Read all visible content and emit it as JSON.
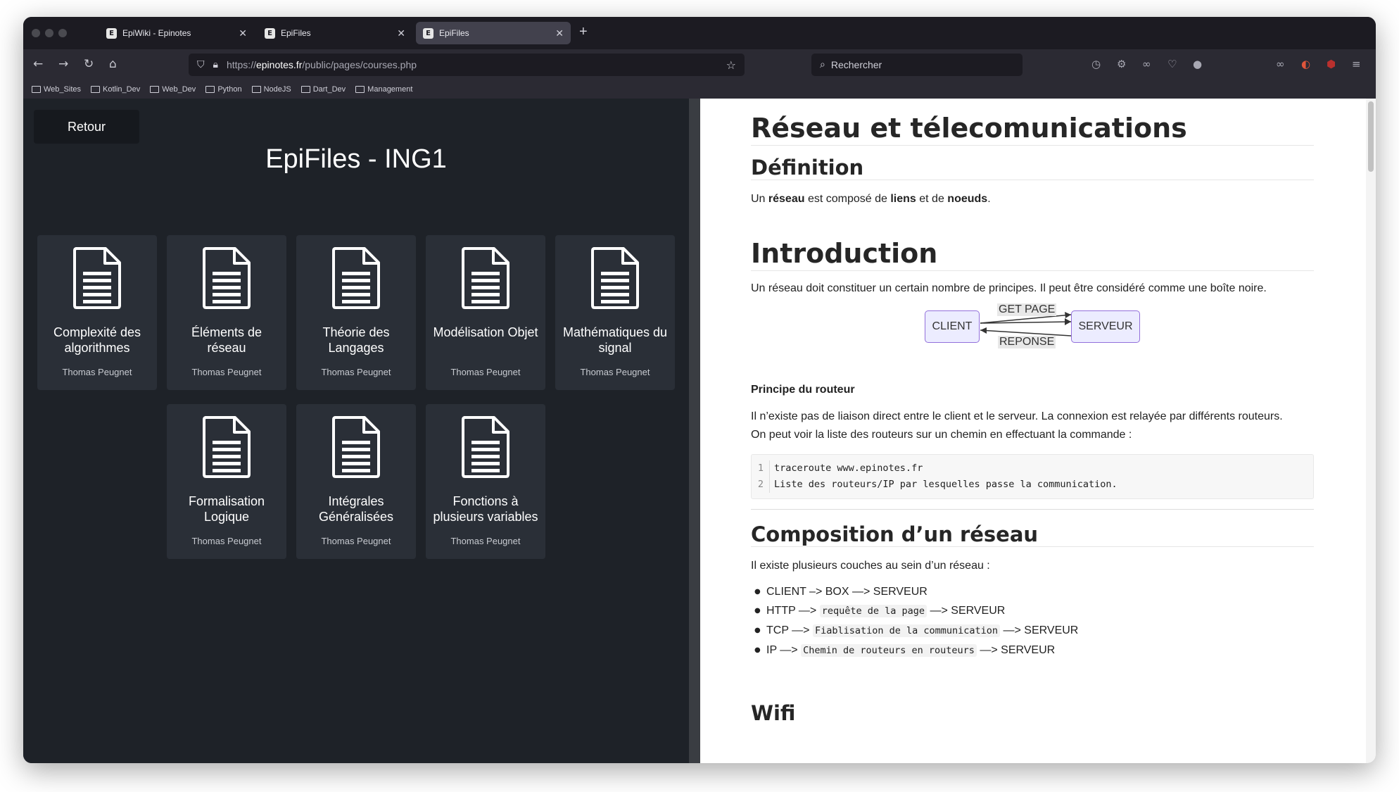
{
  "browser": {
    "tabs": [
      {
        "label": "EpiWiki - Epinotes",
        "favicon": "E"
      },
      {
        "label": "EpiFiles",
        "favicon": "E"
      },
      {
        "label": "EpiFiles",
        "favicon": "E"
      }
    ],
    "active_tab": 2,
    "url_prefix": "https://",
    "url_host": "epinotes.fr",
    "url_path": "/public/pages/courses.php",
    "search_placeholder": "Rechercher",
    "bookmarks": [
      "Web_Sites",
      "Kotlin_Dev",
      "Web_Dev",
      "Python",
      "NodeJS",
      "Dart_Dev",
      "Management"
    ]
  },
  "left": {
    "back_label": "Retour",
    "title": "EpiFiles - ING1",
    "cards": [
      {
        "title": "Complexité des algorithmes",
        "author": "Thomas Peugnet"
      },
      {
        "title": "Éléments de réseau",
        "author": "Thomas Peugnet"
      },
      {
        "title": "Théorie des Langages",
        "author": "Thomas Peugnet"
      },
      {
        "title": "Modélisation Objet",
        "author": "Thomas Peugnet"
      },
      {
        "title": "Mathématiques du signal",
        "author": "Thomas Peugnet"
      },
      {
        "title": "Formalisation Logique",
        "author": "Thomas Peugnet"
      },
      {
        "title": "Intégrales Généralisées",
        "author": "Thomas Peugnet"
      },
      {
        "title": "Fonctions à plusieurs variables",
        "author": "Thomas Peugnet"
      }
    ]
  },
  "doc": {
    "title": "Réseau et télecomunications",
    "definition": {
      "heading": "Définition",
      "t1": "Un ",
      "b1": "réseau",
      "t2": " est composé de ",
      "b2": "liens",
      "t3": " et de ",
      "b3": "noeuds",
      "t4": "."
    },
    "intro": {
      "heading": "Introduction",
      "text": "Un réseau doit constituer un certain nombre de principes. Il peut être considéré comme une boîte noire.",
      "diagram": {
        "client": "CLIENT",
        "server": "SERVEUR",
        "get_label": "GET PAGE",
        "response_label": "REPONSE"
      }
    },
    "routeur": {
      "heading": "Principe du routeur",
      "p1": "Il n’existe pas de liaison direct entre le client et le serveur. La connexion est relayée par différents routeurs.",
      "p2": "On peut voir la liste des routeurs sur un chemin en effectuant la commande :",
      "code": [
        {
          "n": "1",
          "text": "traceroute www.epinotes.fr"
        },
        {
          "n": "2",
          "text": "Liste des routeurs/IP par lesquelles passe la communication."
        }
      ]
    },
    "composition": {
      "heading": "Composition d’un réseau",
      "intro": "Il existe plusieurs couches au sein d’un réseau :",
      "items": [
        {
          "pre": "CLIENT –> BOX —> SERVEUR",
          "code": "",
          "post": ""
        },
        {
          "pre": "HTTP —> ",
          "code": "requête de la page",
          "post": " —> SERVEUR"
        },
        {
          "pre": "TCP —> ",
          "code": "Fiablisation de la communication",
          "post": " —> SERVEUR"
        },
        {
          "pre": "IP —> ",
          "code": "Chemin de routeurs en routeurs",
          "post": " —> SERVEUR"
        }
      ]
    },
    "wifi_heading": "Wifi"
  }
}
